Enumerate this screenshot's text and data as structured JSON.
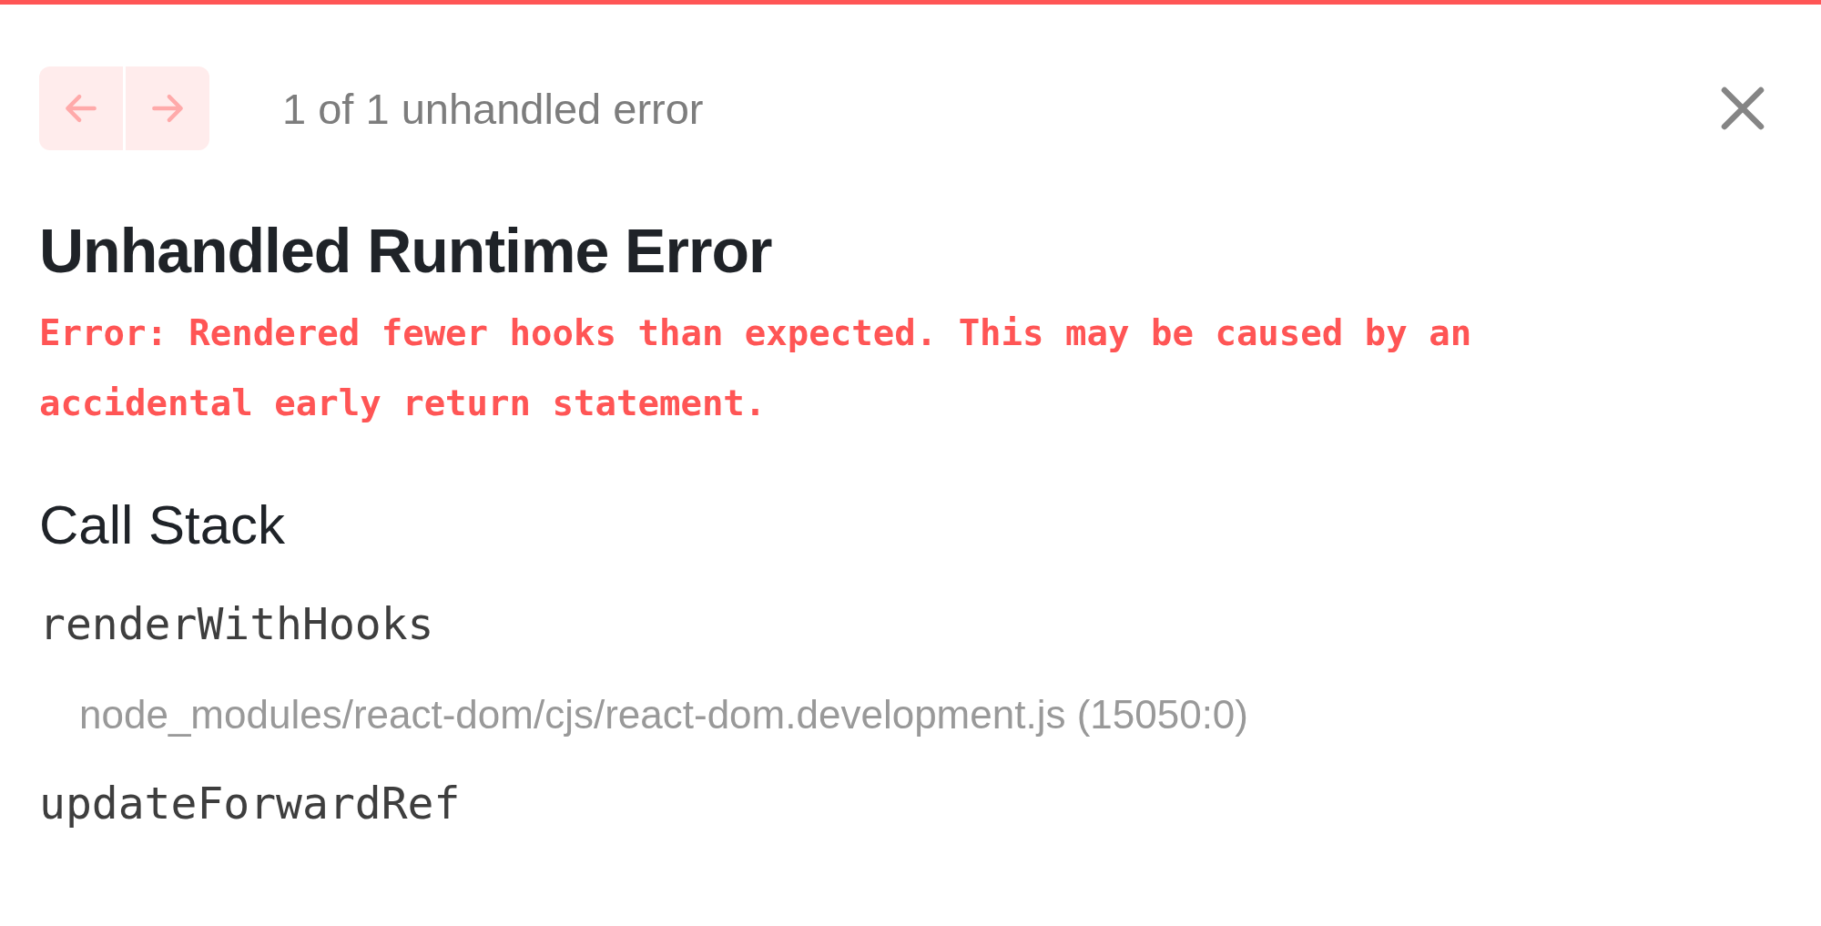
{
  "nav": {
    "buttons": [
      {
        "kind": "previous",
        "disabled": true
      },
      {
        "kind": "next",
        "disabled": true
      }
    ],
    "counter": "1 of 1 unhandled error"
  },
  "title": "Unhandled Runtime Error",
  "message": "Error: Rendered fewer hooks than expected. This may be caused by an accidental early return statement.",
  "call_stack": {
    "heading": "Call Stack",
    "frames": [
      {
        "function": "renderWithHooks",
        "location": "node_modules/react-dom/cjs/react-dom.development.js (15050:0)"
      },
      {
        "function": "updateForwardRef"
      }
    ]
  }
}
